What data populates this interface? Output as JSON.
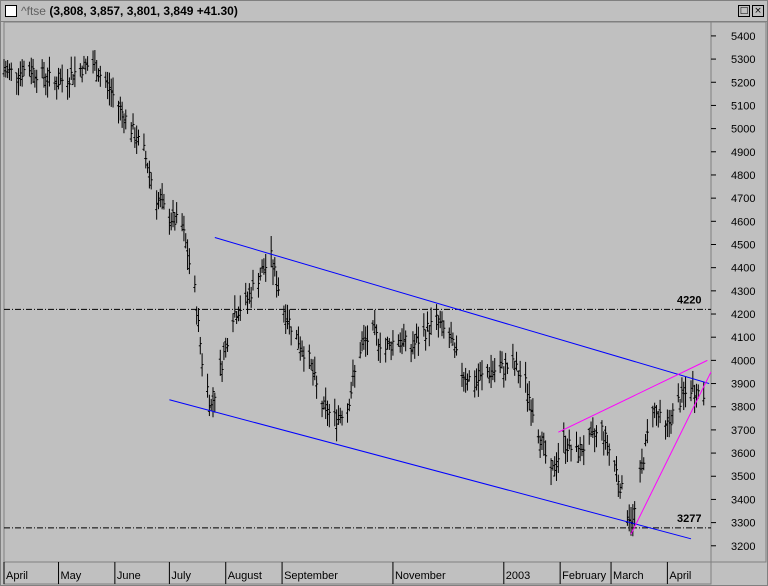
{
  "window": {
    "title_symbol": "^ftse",
    "title_values": "(3,808, 3,857, 3,801, 3,849 +41.30)"
  },
  "chart_data": {
    "type": "candlestick",
    "title": "^ftse (3,808, 3,857, 3,801, 3,849 +41.30)",
    "y_ticks": [
      3200,
      3300,
      3400,
      3500,
      3600,
      3700,
      3800,
      3900,
      4000,
      4100,
      4200,
      4300,
      4400,
      4500,
      4600,
      4700,
      4800,
      4900,
      5000,
      5100,
      5200,
      5300,
      5400
    ],
    "ylim": [
      3130,
      5460
    ],
    "x_labels": [
      "April",
      "May",
      "June",
      "July",
      "August",
      "September",
      "November",
      "2003",
      "February",
      "March",
      "April"
    ],
    "x_range": [
      "2002-04-01",
      "2003-04-25"
    ],
    "horizontal_lines": [
      {
        "label": "4220",
        "value": 4220
      },
      {
        "label": "3277",
        "value": 3277
      }
    ],
    "trendlines": [
      {
        "color": "#0000ff",
        "from": [
          "2002-07-26",
          4530
        ],
        "to": [
          "2003-04-24",
          3900
        ]
      },
      {
        "color": "#0000ff",
        "from": [
          "2002-07-01",
          3830
        ],
        "to": [
          "2003-04-14",
          3230
        ]
      },
      {
        "color": "#ff00ff",
        "from": [
          "2003-01-31",
          3690
        ],
        "to": [
          "2003-04-23",
          4000
        ]
      },
      {
        "color": "#ff00ff",
        "from": [
          "2003-03-12",
          3250
        ],
        "to": [
          "2003-04-25",
          3950
        ]
      }
    ],
    "close_path": [
      [
        "2002-04-01",
        5250
      ],
      [
        "2002-04-08",
        5240
      ],
      [
        "2002-04-15",
        5260
      ],
      [
        "2002-04-22",
        5230
      ],
      [
        "2002-04-29",
        5200
      ],
      [
        "2002-05-06",
        5220
      ],
      [
        "2002-05-13",
        5260
      ],
      [
        "2002-05-20",
        5280
      ],
      [
        "2002-05-27",
        5200
      ],
      [
        "2002-06-03",
        5100
      ],
      [
        "2002-06-10",
        5000
      ],
      [
        "2002-06-17",
        4900
      ],
      [
        "2002-06-24",
        4700
      ],
      [
        "2002-07-01",
        4620
      ],
      [
        "2002-07-08",
        4580
      ],
      [
        "2002-07-15",
        4300
      ],
      [
        "2002-07-19",
        4000
      ],
      [
        "2002-07-24",
        3800
      ],
      [
        "2002-07-29",
        3960
      ],
      [
        "2002-08-05",
        4200
      ],
      [
        "2002-08-12",
        4250
      ],
      [
        "2002-08-19",
        4360
      ],
      [
        "2002-08-26",
        4440
      ],
      [
        "2002-09-02",
        4220
      ],
      [
        "2002-09-09",
        4100
      ],
      [
        "2002-09-16",
        4000
      ],
      [
        "2002-09-23",
        3800
      ],
      [
        "2002-09-30",
        3750
      ],
      [
        "2002-10-07",
        3800
      ],
      [
        "2002-10-14",
        4050
      ],
      [
        "2002-10-21",
        4120
      ],
      [
        "2002-10-28",
        4050
      ],
      [
        "2002-11-04",
        4100
      ],
      [
        "2002-11-11",
        4050
      ],
      [
        "2002-11-18",
        4120
      ],
      [
        "2002-11-25",
        4170
      ],
      [
        "2002-12-02",
        4100
      ],
      [
        "2002-12-09",
        3950
      ],
      [
        "2002-12-16",
        3900
      ],
      [
        "2002-12-23",
        3950
      ],
      [
        "2002-12-30",
        3960
      ],
      [
        "2003-01-06",
        3980
      ],
      [
        "2003-01-13",
        3900
      ],
      [
        "2003-01-20",
        3700
      ],
      [
        "2003-01-27",
        3500
      ],
      [
        "2003-02-03",
        3650
      ],
      [
        "2003-02-10",
        3600
      ],
      [
        "2003-02-17",
        3650
      ],
      [
        "2003-02-24",
        3700
      ],
      [
        "2003-03-03",
        3550
      ],
      [
        "2003-03-10",
        3350
      ],
      [
        "2003-03-13",
        3300
      ],
      [
        "2003-03-17",
        3500
      ],
      [
        "2003-03-24",
        3800
      ],
      [
        "2003-03-31",
        3700
      ],
      [
        "2003-04-07",
        3820
      ],
      [
        "2003-04-14",
        3880
      ],
      [
        "2003-04-21",
        3849
      ]
    ]
  }
}
